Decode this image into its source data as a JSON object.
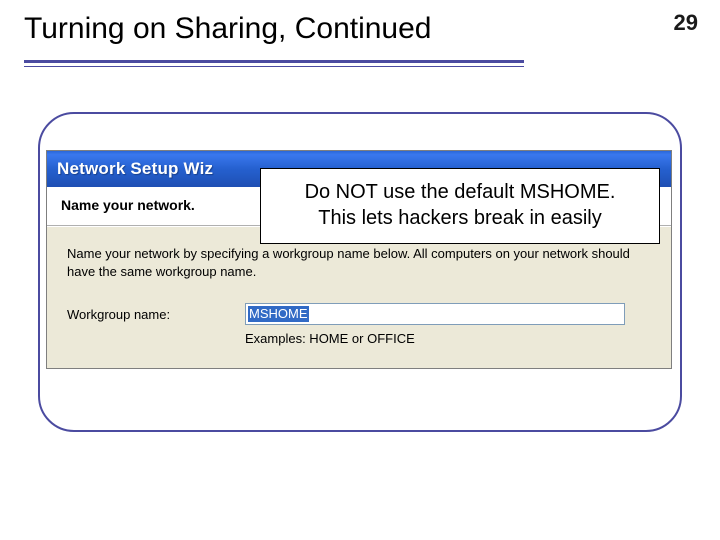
{
  "slide": {
    "title": "Turning on Sharing, Continued",
    "number": "29"
  },
  "dialog": {
    "title": "Network Setup Wiz",
    "subtitle": "Name your network.",
    "instructions": "Name your network by specifying a workgroup name below. All computers on your network should have the same workgroup name.",
    "workgroup_label": "Workgroup name:",
    "workgroup_value": "MSHOME",
    "examples_text": "Examples: HOME or OFFICE"
  },
  "callout": {
    "line1": "Do NOT use the default MSHOME.",
    "line2": "This lets hackers break in easily"
  }
}
